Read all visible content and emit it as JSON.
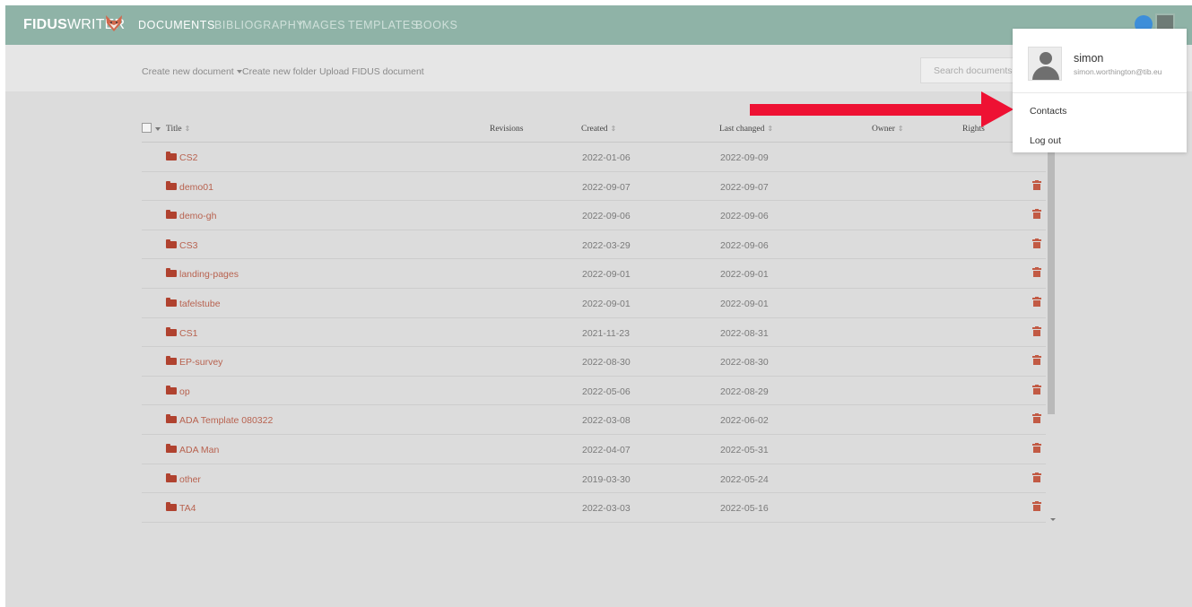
{
  "header": {
    "logo_bold": "FIDUS",
    "logo_light": "WRITER",
    "nav": [
      {
        "label": "DOCUMENTS",
        "active": true
      },
      {
        "label": "BIBLIOGRAPHY",
        "active": false
      },
      {
        "label": "IMAGES",
        "active": false
      },
      {
        "label": "TEMPLATES",
        "active": false
      },
      {
        "label": "BOOKS",
        "active": false
      }
    ],
    "icons": {
      "logo": "fox-icon",
      "help": "help-icon",
      "avatar": "user-avatar-icon"
    }
  },
  "toolbar": {
    "create_document": "Create new document",
    "create_folder": "Create new folder",
    "upload": "Upload FIDUS document",
    "search_placeholder": "Search documents"
  },
  "table": {
    "columns": {
      "title": "Title",
      "revisions": "Revisions",
      "created": "Created",
      "last_changed": "Last changed",
      "owner": "Owner",
      "rights": "Rights"
    },
    "rows": [
      {
        "name": "CS2",
        "created": "2022-01-06",
        "changed": "2022-09-09"
      },
      {
        "name": "demo01",
        "created": "2022-09-07",
        "changed": "2022-09-07"
      },
      {
        "name": "demo-gh",
        "created": "2022-09-06",
        "changed": "2022-09-06"
      },
      {
        "name": "CS3",
        "created": "2022-03-29",
        "changed": "2022-09-06"
      },
      {
        "name": "landing-pages",
        "created": "2022-09-01",
        "changed": "2022-09-01"
      },
      {
        "name": "tafelstube",
        "created": "2022-09-01",
        "changed": "2022-09-01"
      },
      {
        "name": "CS1",
        "created": "2021-11-23",
        "changed": "2022-08-31"
      },
      {
        "name": "EP-survey",
        "created": "2022-08-30",
        "changed": "2022-08-30"
      },
      {
        "name": "op",
        "created": "2022-05-06",
        "changed": "2022-08-29"
      },
      {
        "name": "ADA Template 080322",
        "created": "2022-03-08",
        "changed": "2022-06-02"
      },
      {
        "name": "ADA Man",
        "created": "2022-04-07",
        "changed": "2022-05-31"
      },
      {
        "name": "other",
        "created": "2019-03-30",
        "changed": "2022-05-24"
      },
      {
        "name": "TA4",
        "created": "2022-03-03",
        "changed": "2022-05-16"
      }
    ]
  },
  "user_menu": {
    "username": "simon",
    "email": "simon.worthington@tib.eu",
    "items": [
      "Contacts",
      "Log out"
    ]
  },
  "colors": {
    "nav_bg": "#8fb3a7",
    "folder_link": "#b8624f",
    "delete_icon": "#c25a44",
    "annotation_arrow": "#ee1133"
  }
}
